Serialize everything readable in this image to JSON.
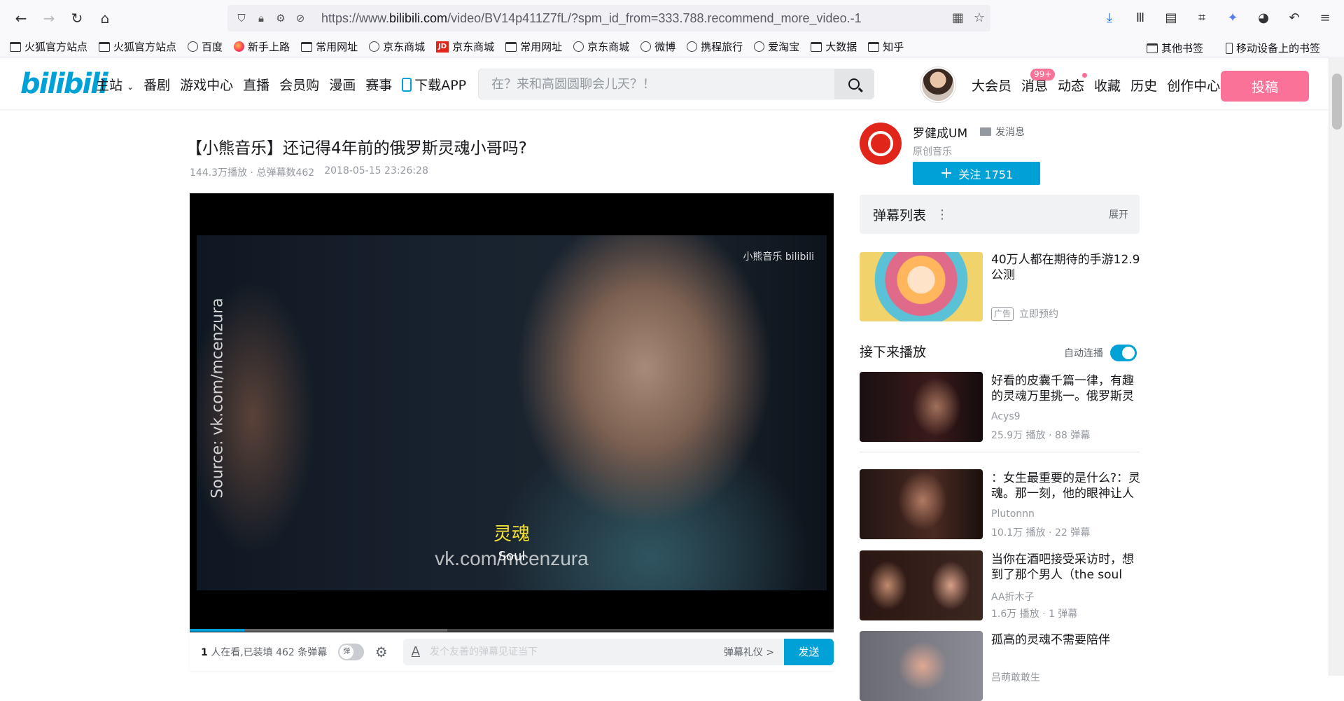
{
  "browser": {
    "url_prefix": "https://www.",
    "url_host": "bilibili.com",
    "url_path": "/video/BV14p411Z7fL/?spm_id_from=333.788.recommend_more_video.-1"
  },
  "bookmarks": [
    {
      "label": "火狐官方站点",
      "icon": "folder"
    },
    {
      "label": "火狐官方站点",
      "icon": "folder"
    },
    {
      "label": "百度",
      "icon": "globe"
    },
    {
      "label": "新手上路",
      "icon": "firefox"
    },
    {
      "label": "常用网址",
      "icon": "folder"
    },
    {
      "label": "京东商城",
      "icon": "globe"
    },
    {
      "label": "京东商城",
      "icon": "jd"
    },
    {
      "label": "常用网址",
      "icon": "folder"
    },
    {
      "label": "京东商城",
      "icon": "globe"
    },
    {
      "label": "微博",
      "icon": "globe"
    },
    {
      "label": "携程旅行",
      "icon": "globe"
    },
    {
      "label": "爱淘宝",
      "icon": "globe"
    },
    {
      "label": "大数据",
      "icon": "folder"
    },
    {
      "label": "知乎",
      "icon": "folder"
    }
  ],
  "bookmarks_right": [
    {
      "label": "其他书签",
      "icon": "folder"
    },
    {
      "label": "移动设备上的书签",
      "icon": "phone"
    }
  ],
  "header": {
    "logo": "bilibili",
    "nav": [
      "主站",
      "番剧",
      "游戏中心",
      "直播",
      "会员购",
      "漫画",
      "赛事",
      "下载APP"
    ],
    "search_placeholder": "在？来和高圆圆聊会儿天？！",
    "user_nav": [
      "大会员",
      "消息",
      "动态",
      "收藏",
      "历史",
      "创作中心"
    ],
    "message_badge": "99+",
    "upload_label": "投稿"
  },
  "video": {
    "title": "【小熊音乐】还记得4年前的俄罗斯灵魂小哥吗?",
    "plays": "144.3万播放",
    "danmaku_total": "总弹幕数462",
    "date": "2018-05-15 23:26:28",
    "watermark": "小熊音乐 bilibili",
    "side_text": "Source: vk.com/mcenzura",
    "subtitle_cn": "灵魂",
    "subtitle_en": "Soul",
    "vk_mark": "vk.com/mcenzura",
    "progress_played": 0.085,
    "progress_buffered": 0.4
  },
  "danmaku_bar": {
    "viewers_count": "1",
    "viewers_text": " 人在看,已装填 462 条弹幕",
    "toggle_label": "弹",
    "input_placeholder": "发个友善的弹幕见证当下",
    "etiquette": "弹幕礼仪 >",
    "send": "发送"
  },
  "uploader": {
    "name": "罗健成UM",
    "message": "发消息",
    "desc": "原创音乐",
    "follow": "关注 1751"
  },
  "danmaku_list": {
    "title": "弹幕列表",
    "expand": "展开"
  },
  "ad": {
    "title": "40万人都在期待的手游12.9公测",
    "tag": "广告",
    "action": "立即预约"
  },
  "next": {
    "label": "接下来播放",
    "autoplay": "自动连播"
  },
  "recommendations": [
    {
      "title": "好看的皮囊千篇一律，有趣的灵魂万里挑一。俄罗斯灵魂小哥",
      "author": "Acys9",
      "stats": "25.9万 播放 · 88 弹幕"
    },
    {
      "title": "：女生最重要的是什么?：灵魂。那一刻，他的眼神让人心动",
      "author": "Plutonnn",
      "stats": "10.1万 播放 · 22 弹幕"
    },
    {
      "title": "当你在酒吧接受采访时，想到了那个男人（the soul of）",
      "author": "AA折木子",
      "stats": "1.6万 播放 · 1 弹幕"
    },
    {
      "title": "孤高的灵魂不需要陪伴",
      "author": "吕萌敢敢生",
      "stats": ""
    }
  ]
}
